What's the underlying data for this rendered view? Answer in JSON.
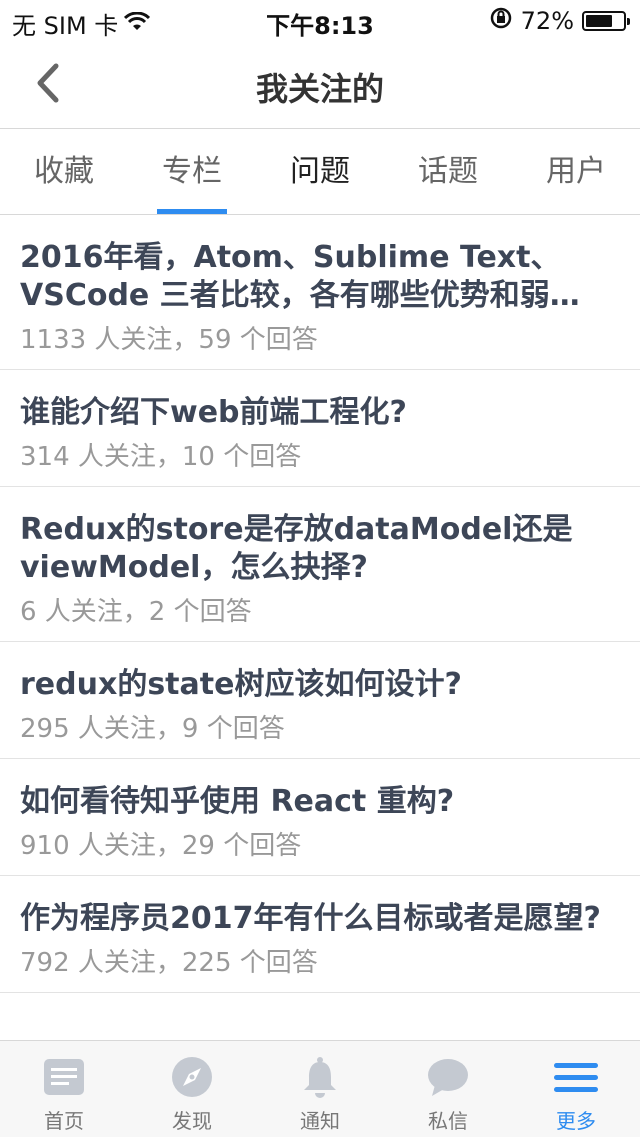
{
  "status_bar": {
    "carrier": "无 SIM 卡",
    "time": "下午8:13",
    "battery_percent": "72%",
    "battery_level": 0.72
  },
  "nav": {
    "back_icon": "chevron-left-icon",
    "title": "我关注的"
  },
  "tabs": [
    {
      "label": "收藏",
      "active": false
    },
    {
      "label": "专栏",
      "active": false
    },
    {
      "label": "问题",
      "active": true
    },
    {
      "label": "话题",
      "active": false
    },
    {
      "label": "用户",
      "active": false
    }
  ],
  "questions": [
    {
      "title": "2016年看，Atom、Sublime Text、VSCode 三者比较，各有哪些优势和弱…",
      "meta": "1133 人关注，59 个回答"
    },
    {
      "title": "谁能介绍下web前端工程化?",
      "meta": "314 人关注，10 个回答"
    },
    {
      "title": "Redux的store是存放dataModel还是viewModel，怎么抉择?",
      "meta": "6 人关注，2 个回答"
    },
    {
      "title": "redux的state树应该如何设计?",
      "meta": "295 人关注，9 个回答"
    },
    {
      "title": "如何看待知乎使用 React 重构?",
      "meta": "910 人关注，29 个回答"
    },
    {
      "title": "作为程序员2017年有什么目标或者是愿望?",
      "meta": "792 人关注，225 个回答"
    }
  ],
  "tabbar": [
    {
      "label": "首页",
      "icon": "home-doc-icon",
      "active": false
    },
    {
      "label": "发现",
      "icon": "compass-icon",
      "active": false
    },
    {
      "label": "通知",
      "icon": "bell-icon",
      "active": false
    },
    {
      "label": "私信",
      "icon": "chat-bubble-icon",
      "active": false
    },
    {
      "label": "更多",
      "icon": "menu-icon",
      "active": true
    }
  ],
  "colors": {
    "accent": "#2e8cf0",
    "icon_gray": "#c4c9d1",
    "title_text": "#3d4657",
    "meta_text": "#999999"
  }
}
